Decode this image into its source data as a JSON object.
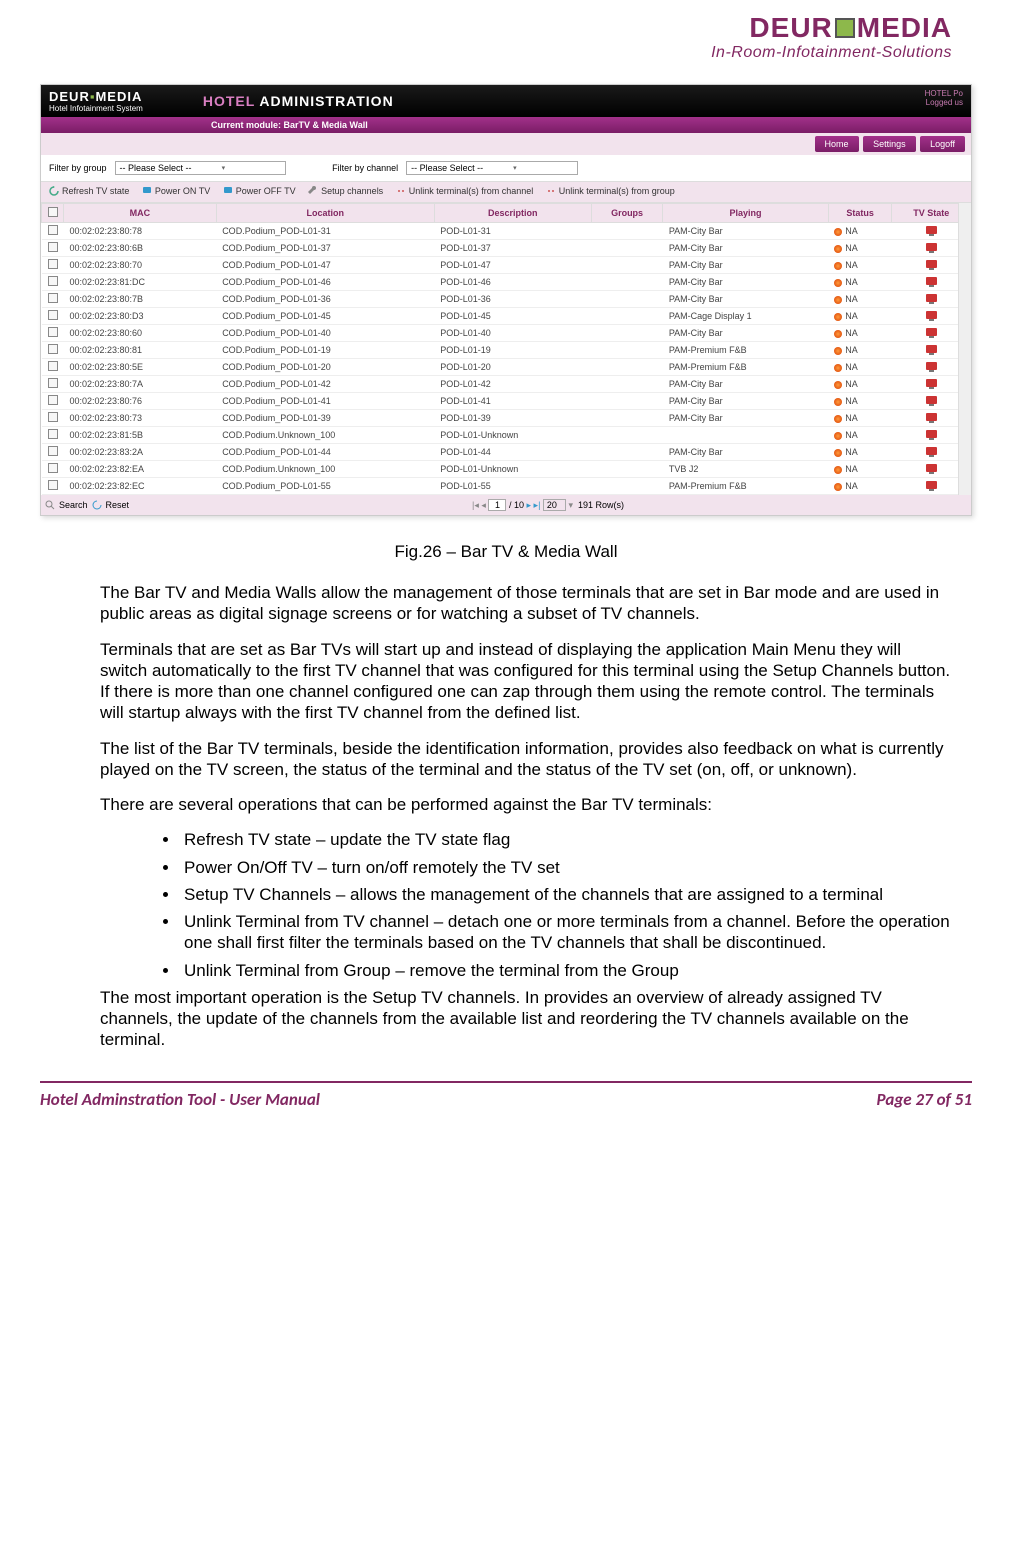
{
  "header": {
    "logo_left": "DEUR",
    "logo_right": "MEDIA",
    "tagline": "In-Room-Infotainment-Solutions"
  },
  "screenshot": {
    "brand": "DEUROMEDIA",
    "brand_sub": "Hotel Infotainment System",
    "title_hotel": "HOTEL",
    "title_admin": " ADMINISTRATION",
    "po_line1": "HOTEL Po",
    "po_line2": "Logged us",
    "module_label": "Current module: ",
    "module_value": "BarTV & Media Wall",
    "nav": [
      "Home",
      "Settings",
      "Logoff"
    ],
    "filter_group_label": "Filter by group",
    "filter_channel_label": "Filter by channel",
    "please_select": "-- Please Select --",
    "toolbar": [
      "Refresh TV state",
      "Power ON TV",
      "Power OFF TV",
      "Setup channels",
      "Unlink terminal(s) from channel",
      "Unlink terminal(s) from group"
    ],
    "columns": [
      "",
      "MAC",
      "Location",
      "Description",
      "Groups",
      "Playing",
      "Status",
      "TV State"
    ],
    "rows": [
      {
        "mac": "00:02:02:23:80:78",
        "loc": "COD.Podium_POD-L01-31",
        "desc": "POD-L01-31",
        "grp": "",
        "play": "PAM-City Bar",
        "stat": "NA"
      },
      {
        "mac": "00:02:02:23:80:6B",
        "loc": "COD.Podium_POD-L01-37",
        "desc": "POD-L01-37",
        "grp": "",
        "play": "PAM-City Bar",
        "stat": "NA"
      },
      {
        "mac": "00:02:02:23:80:70",
        "loc": "COD.Podium_POD-L01-47",
        "desc": "POD-L01-47",
        "grp": "",
        "play": "PAM-City Bar",
        "stat": "NA"
      },
      {
        "mac": "00:02:02:23:81:DC",
        "loc": "COD.Podium_POD-L01-46",
        "desc": "POD-L01-46",
        "grp": "",
        "play": "PAM-City Bar",
        "stat": "NA"
      },
      {
        "mac": "00:02:02:23:80:7B",
        "loc": "COD.Podium_POD-L01-36",
        "desc": "POD-L01-36",
        "grp": "",
        "play": "PAM-City Bar",
        "stat": "NA"
      },
      {
        "mac": "00:02:02:23:80:D3",
        "loc": "COD.Podium_POD-L01-45",
        "desc": "POD-L01-45",
        "grp": "",
        "play": "PAM-Cage Display 1",
        "stat": "NA"
      },
      {
        "mac": "00:02:02:23:80:60",
        "loc": "COD.Podium_POD-L01-40",
        "desc": "POD-L01-40",
        "grp": "",
        "play": "PAM-City Bar",
        "stat": "NA"
      },
      {
        "mac": "00:02:02:23:80:81",
        "loc": "COD.Podium_POD-L01-19",
        "desc": "POD-L01-19",
        "grp": "",
        "play": "PAM-Premium F&B",
        "stat": "NA"
      },
      {
        "mac": "00:02:02:23:80:5E",
        "loc": "COD.Podium_POD-L01-20",
        "desc": "POD-L01-20",
        "grp": "",
        "play": "PAM-Premium F&B",
        "stat": "NA"
      },
      {
        "mac": "00:02:02:23:80:7A",
        "loc": "COD.Podium_POD-L01-42",
        "desc": "POD-L01-42",
        "grp": "",
        "play": "PAM-City Bar",
        "stat": "NA"
      },
      {
        "mac": "00:02:02:23:80:76",
        "loc": "COD.Podium_POD-L01-41",
        "desc": "POD-L01-41",
        "grp": "",
        "play": "PAM-City Bar",
        "stat": "NA"
      },
      {
        "mac": "00:02:02:23:80:73",
        "loc": "COD.Podium_POD-L01-39",
        "desc": "POD-L01-39",
        "grp": "",
        "play": "PAM-City Bar",
        "stat": "NA"
      },
      {
        "mac": "00:02:02:23:81:5B",
        "loc": "COD.Podium.Unknown_100",
        "desc": "POD-L01-Unknown",
        "grp": "",
        "play": "",
        "stat": "NA"
      },
      {
        "mac": "00:02:02:23:83:2A",
        "loc": "COD.Podium_POD-L01-44",
        "desc": "POD-L01-44",
        "grp": "",
        "play": "PAM-City Bar",
        "stat": "NA"
      },
      {
        "mac": "00:02:02:23:82:EA",
        "loc": "COD.Podium.Unknown_100",
        "desc": "POD-L01-Unknown",
        "grp": "",
        "play": "TVB J2",
        "stat": "NA"
      },
      {
        "mac": "00:02:02:23:82:EC",
        "loc": "COD.Podium_POD-L01-55",
        "desc": "POD-L01-55",
        "grp": "",
        "play": "PAM-Premium F&B",
        "stat": "NA"
      }
    ],
    "search_label": "Search",
    "reset_label": "Reset",
    "pager": {
      "page": "1",
      "total_pages": "/ 10",
      "page_size": "20",
      "rows": "191 Row(s)"
    }
  },
  "caption": "Fig.26 – Bar TV & Media Wall",
  "paragraphs": {
    "p1": "The Bar TV and Media Walls allow the management of those terminals that are set in Bar mode and are used in public areas as digital signage screens or for watching a subset of TV channels.",
    "p2": "Terminals that are set as Bar TVs will start up and instead of displaying the application Main Menu they will switch automatically to the first TV channel that was configured for this terminal using the Setup Channels button. If there is more than one channel configured one can zap through them using the remote control. The terminals will startup always with the first TV channel from the defined list.",
    "p3": "The list of the Bar TV terminals, beside the identification information, provides also feedback on what is currently played on the TV screen, the status of the terminal and the status of the TV set (on, off, or unknown).",
    "p4": "There are several operations that can be performed against the Bar TV terminals:",
    "p5": "The most important operation is the Setup TV channels. In provides an overview of already assigned TV channels, the update of the channels from the available list and reordering the TV channels available on the terminal."
  },
  "bullets": [
    "Refresh TV state – update the TV state flag",
    "Power On/Off TV – turn on/off remotely the TV set",
    "Setup TV Channels – allows the management of the channels that are assigned to a terminal",
    "Unlink Terminal from TV channel – detach one or more terminals from a channel. Before the operation one shall first filter the terminals based on the TV channels that shall be discontinued.",
    "Unlink Terminal from Group – remove the terminal from the Group"
  ],
  "footer": {
    "left": "Hotel Adminstration Tool - User Manual",
    "right": "Page 27 of 51"
  }
}
